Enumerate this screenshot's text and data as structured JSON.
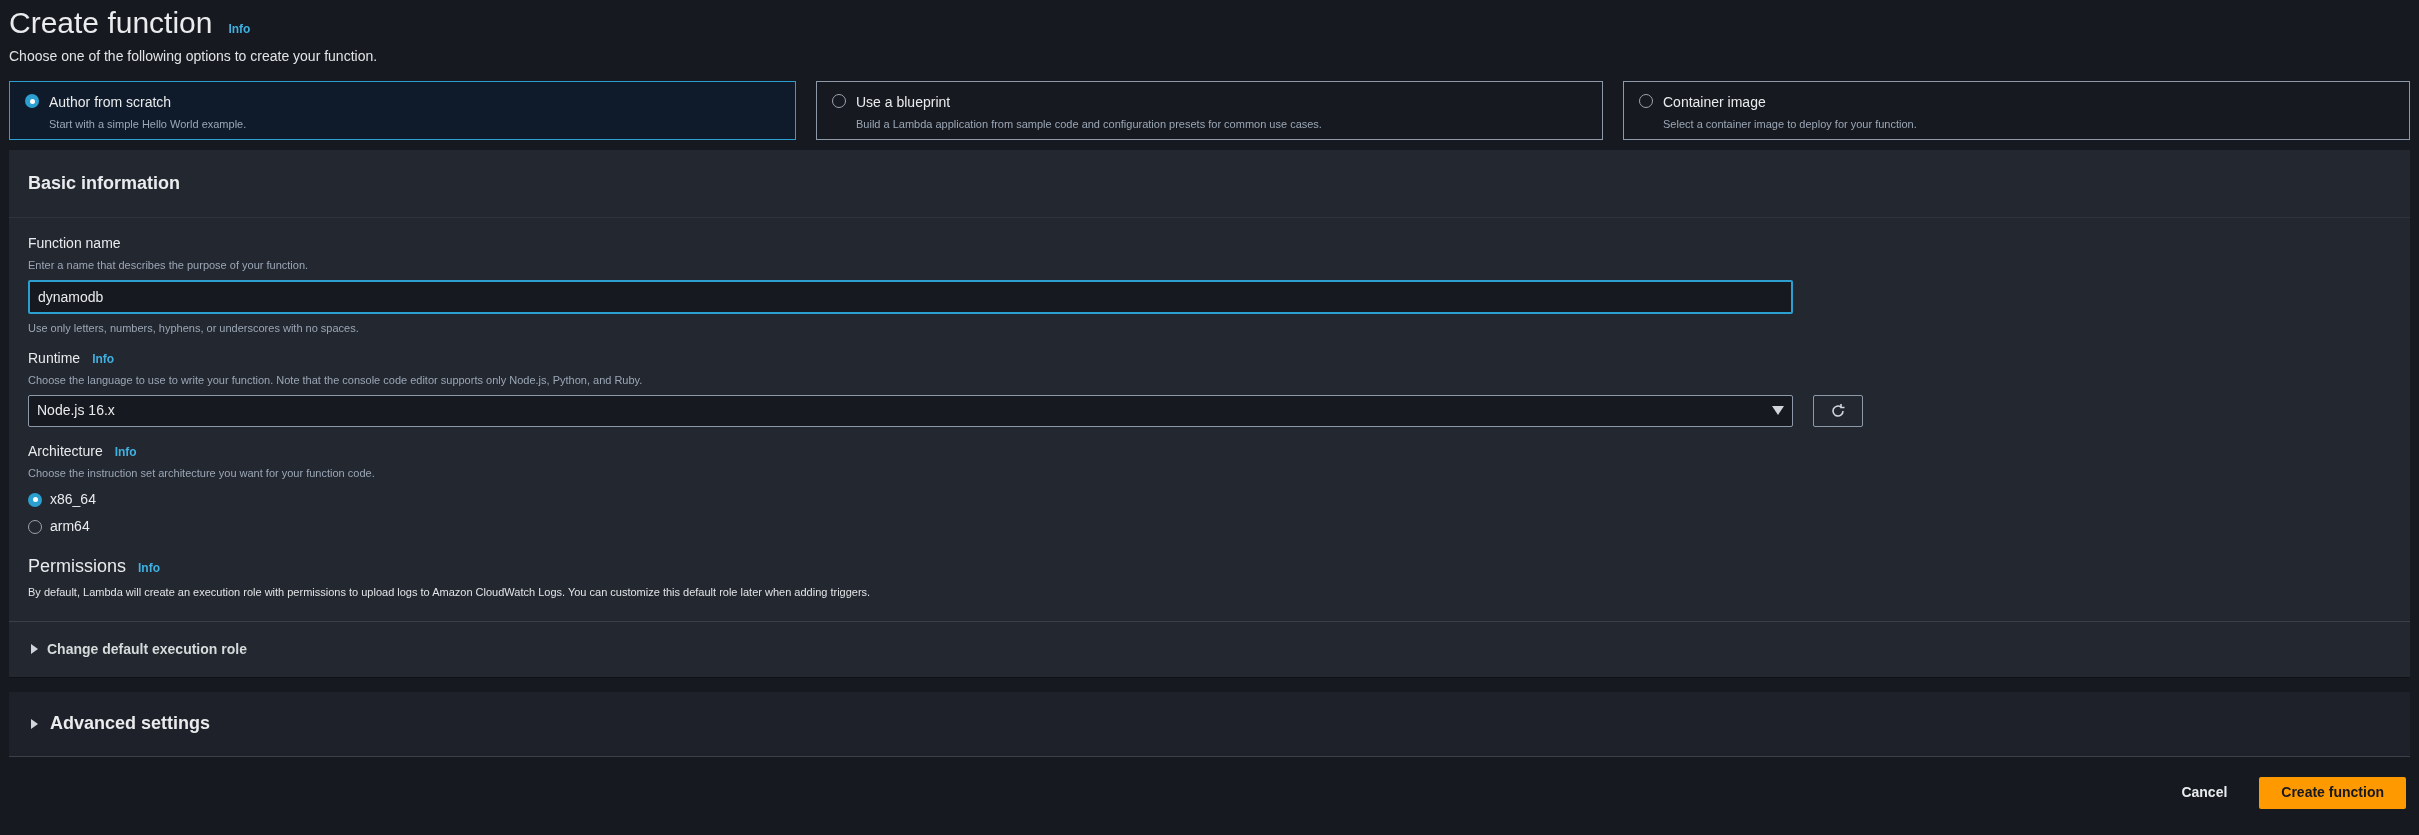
{
  "header": {
    "title": "Create function",
    "info": "Info",
    "description": "Choose one of the following options to create your function."
  },
  "options": [
    {
      "label": "Author from scratch",
      "description": "Start with a simple Hello World example.",
      "selected": true
    },
    {
      "label": "Use a blueprint",
      "description": "Build a Lambda application from sample code and configuration presets for common use cases.",
      "selected": false
    },
    {
      "label": "Container image",
      "description": "Select a container image to deploy for your function.",
      "selected": false
    }
  ],
  "basic_information": {
    "title": "Basic information",
    "function_name": {
      "label": "Function name",
      "description": "Enter a name that describes the purpose of your function.",
      "value": "dynamodb",
      "constraint": "Use only letters, numbers, hyphens, or underscores with no spaces."
    },
    "runtime": {
      "label": "Runtime",
      "info": "Info",
      "description": "Choose the language to use to write your function. Note that the console code editor supports only Node.js, Python, and Ruby.",
      "value": "Node.js 16.x"
    },
    "architecture": {
      "label": "Architecture",
      "info": "Info",
      "description": "Choose the instruction set architecture you want for your function code.",
      "options": [
        {
          "label": "x86_64",
          "selected": true
        },
        {
          "label": "arm64",
          "selected": false
        }
      ]
    },
    "permissions": {
      "title": "Permissions",
      "info": "Info",
      "description": "By default, Lambda will create an execution role with permissions to upload logs to Amazon CloudWatch Logs. You can customize this default role later when adding triggers."
    },
    "execution_role": {
      "label": "Change default execution role",
      "expanded": false
    }
  },
  "advanced_settings": {
    "label": "Advanced settings",
    "expanded": false
  },
  "footer": {
    "cancel": "Cancel",
    "submit": "Create function"
  }
}
